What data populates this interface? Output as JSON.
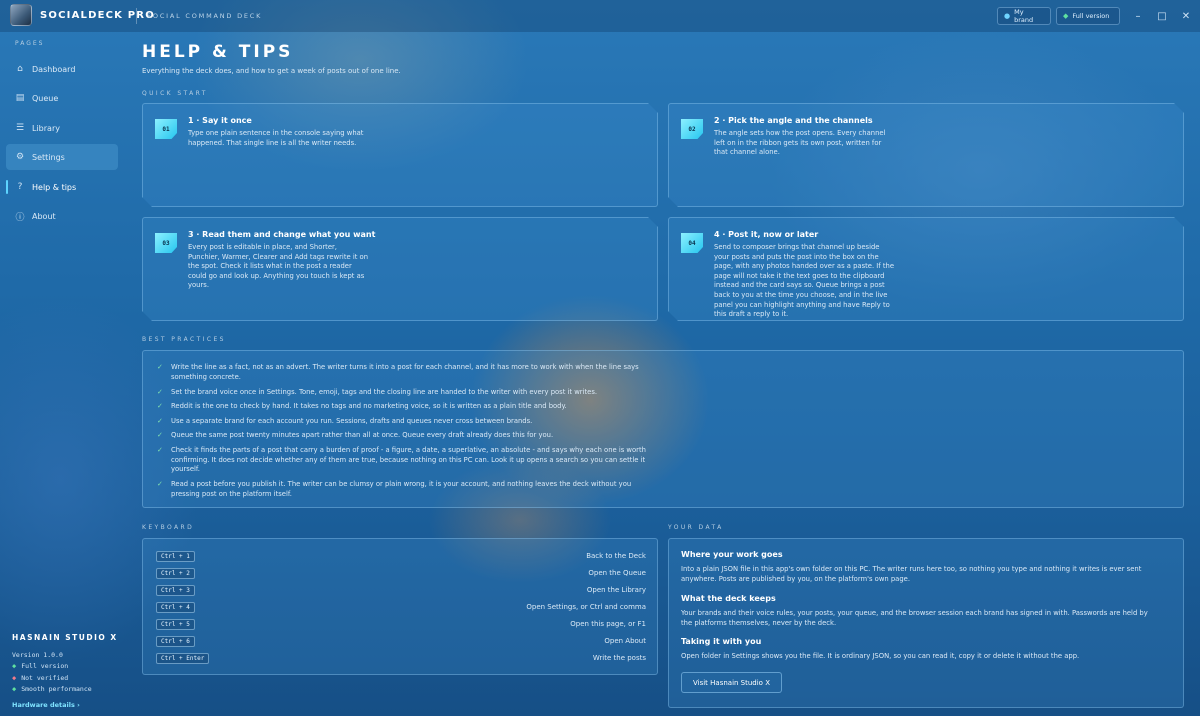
{
  "app": {
    "name": "SOCIALDECK PRO",
    "tagline": "SOCIAL COMMAND DECK"
  },
  "header": {
    "brand_btn": "My brand",
    "version_btn": "Full version",
    "brand_icon": "person-icon",
    "version_icon": "star-icon"
  },
  "window": {
    "minimize": "–",
    "maximize": "□",
    "close": "✕"
  },
  "sidebar": {
    "heading": "PAGES",
    "items": [
      {
        "label": "Dashboard",
        "icon": "home-icon",
        "glyph": "⌂"
      },
      {
        "label": "Queue",
        "icon": "queue-icon",
        "glyph": "▤"
      },
      {
        "label": "Library",
        "icon": "library-icon",
        "glyph": "☰"
      },
      {
        "label": "Settings",
        "icon": "gear-icon",
        "glyph": "⚙"
      },
      {
        "label": "Help & tips",
        "icon": "help-icon",
        "glyph": "?"
      },
      {
        "label": "About",
        "icon": "info-icon",
        "glyph": "ⓘ"
      }
    ],
    "studio": "HASNAIN STUDIO X",
    "version": "Version 1.0.0",
    "status": [
      {
        "label": "Full version",
        "color": "#5fe0a0"
      },
      {
        "label": "Not verified",
        "color": "#f07a8a"
      },
      {
        "label": "Smooth performance",
        "color": "#5fe0a0"
      }
    ],
    "hardware_link": "Hardware details ›"
  },
  "page": {
    "title": "HELP & TIPS",
    "subtitle": "Everything the deck does, and how to get a week of posts out of one line."
  },
  "quick_start": {
    "heading": "QUICK START",
    "cards": [
      {
        "num": "01",
        "title": "1 · Say it once",
        "body": "Type one plain sentence in the console saying what happened. That single line is all the writer needs."
      },
      {
        "num": "02",
        "title": "2 · Pick the angle and the channels",
        "body": "The angle sets how the post opens. Every channel left on in the ribbon gets its own post, written for that channel alone."
      },
      {
        "num": "03",
        "title": "3 · Read them and change what you want",
        "body": "Every post is editable in place, and Shorter, Punchier, Warmer, Clearer and Add tags rewrite it on the spot. Check it lists what in the post a reader could go and look up. Anything you touch is kept as yours."
      },
      {
        "num": "04",
        "title": "4 · Post it, now or later",
        "body": "Send to composer brings that channel up beside your posts and puts the post into the box on the page, with any photos handed over as a paste. If the page will not take it the text goes to the clipboard instead and the card says so. Queue brings a post back to you at the time you choose, and in the live panel you can highlight anything and have Reply to this draft a reply to it."
      }
    ]
  },
  "best_practices": {
    "heading": "BEST PRACTICES",
    "items": [
      "Write the line as a fact, not as an advert. The writer turns it into a post for each channel, and it has more to work with when the line says something concrete.",
      "Set the brand voice once in Settings. Tone, emoji, tags and the closing line are handed to the writer with every post it writes.",
      "Reddit is the one to check by hand. It takes no tags and no marketing voice, so it is written as a plain title and body.",
      "Use a separate brand for each account you run. Sessions, drafts and queues never cross between brands.",
      "Queue the same post twenty minutes apart rather than all at once. Queue every draft already does this for you.",
      "Check it finds the parts of a post that carry a burden of proof - a figure, a date, a superlative, an absolute - and says why each one is worth confirming. It does not decide whether any of them are true, because nothing on this PC can. Look it up opens a search so you can settle it yourself.",
      "Read a post before you publish it. The writer can be clumsy or plain wrong, it is your account, and nothing leaves the deck without you pressing post on the platform itself."
    ]
  },
  "keyboard": {
    "heading": "KEYBOARD",
    "rows": [
      {
        "keys": "Ctrl + 1",
        "desc": "Back to the Deck"
      },
      {
        "keys": "Ctrl + 2",
        "desc": "Open the Queue"
      },
      {
        "keys": "Ctrl + 3",
        "desc": "Open the Library"
      },
      {
        "keys": "Ctrl + 4",
        "desc": "Open Settings, or Ctrl and comma"
      },
      {
        "keys": "Ctrl + 5",
        "desc": "Open this page, or F1"
      },
      {
        "keys": "Ctrl + 6",
        "desc": "Open About"
      },
      {
        "keys": "Ctrl + Enter",
        "desc": "Write the posts"
      }
    ]
  },
  "your_data": {
    "heading": "YOUR DATA",
    "sections": [
      {
        "title": "Where your work goes",
        "body": "Into a plain JSON file in this app's own folder on this PC. The writer runs here too, so nothing you type and nothing it writes is ever sent anywhere. Posts are published by you, on the platform's own page."
      },
      {
        "title": "What the deck keeps",
        "body": "Your brands and their voice rules, your posts, your queue, and the browser session each brand has signed in with. Passwords are held by the platforms themselves, never by the deck."
      },
      {
        "title": "Taking it with you",
        "body": "Open folder in Settings shows you the file. It is ordinary JSON, so you can read it, copy it or delete it without the app."
      }
    ],
    "visit_button": "Visit Hasnain Studio X"
  }
}
